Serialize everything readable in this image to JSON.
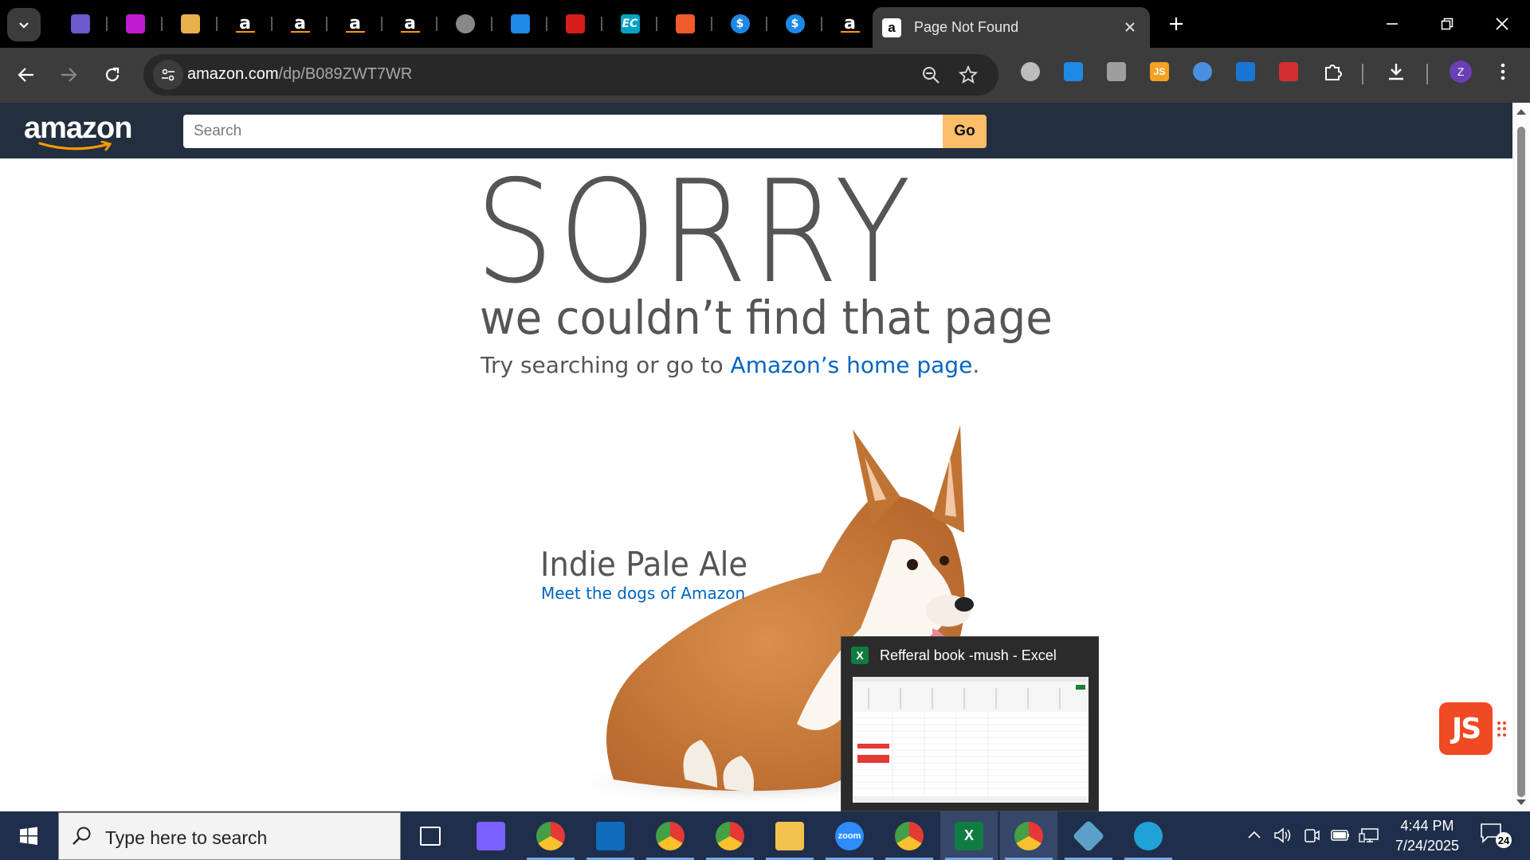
{
  "browser": {
    "pinned_tabs": [
      {
        "icon": "cube-icon",
        "color": "#6a5acd"
      },
      {
        "icon": "heart-app-icon",
        "color": "#c21ad1"
      },
      {
        "icon": "box-icon",
        "color": "#e8b04b"
      },
      {
        "icon": "amazon-icon",
        "color": "#ffffff"
      },
      {
        "icon": "amazon-icon",
        "color": "#ffffff"
      },
      {
        "icon": "amazon-icon",
        "color": "#ffffff"
      },
      {
        "icon": "amazon-icon",
        "color": "#ffffff"
      },
      {
        "icon": "globe-icon",
        "color": "#888888"
      },
      {
        "icon": "g-app-icon",
        "color": "#1e88e5"
      },
      {
        "icon": "dh-icon",
        "color": "#d81b1b"
      },
      {
        "icon": "ec-icon",
        "color": "#00a3c4",
        "text": "EC"
      },
      {
        "icon": "stack-icon",
        "color": "#ef5b2b"
      },
      {
        "icon": "dollar-icon",
        "color": "#1e88e5",
        "text": "$"
      },
      {
        "icon": "dollar-icon",
        "color": "#1e88e5",
        "text": "$"
      },
      {
        "icon": "amazon-icon",
        "color": "#ffffff"
      }
    ],
    "active_tab": {
      "title": "Page Not Found"
    },
    "url": {
      "domain": "amazon.com",
      "path": "/dp/B089ZWT7WR"
    },
    "profile_initial": "Z",
    "extensions": [
      {
        "icon": "globe-grid-icon",
        "color": "#bdbdbd"
      },
      {
        "icon": "puzzle-plus-icon",
        "color": "#1e88e5"
      },
      {
        "icon": "bike-icon",
        "color": "#9e9e9e"
      },
      {
        "icon": "js-icon",
        "color": "#f4a024",
        "text": "JS"
      },
      {
        "icon": "circle-icon",
        "color": "#4a90e2"
      },
      {
        "icon": "bars-icon",
        "color": "#1976d2"
      },
      {
        "icon": "arrow-icon",
        "color": "#d32f2f"
      }
    ]
  },
  "amazon": {
    "logo_text": "amazon",
    "search_placeholder": "Search",
    "go_label": "Go",
    "heading": "SORRY",
    "subheading": "we couldn’t find that page",
    "try_prefix": "Try searching or go to ",
    "home_link": "Amazon’s home page",
    "try_suffix": ".",
    "dog_name": "Indie Pale Ale",
    "dog_link": "Meet the dogs of Amazon",
    "fab_label": "JS"
  },
  "excel_preview": {
    "title": "Refferal book -mush - Excel",
    "icon_letter": "X"
  },
  "taskbar": {
    "search_placeholder": "Type here to search",
    "apps": [
      {
        "name": "task-view-icon"
      },
      {
        "name": "copilot-icon"
      },
      {
        "name": "chrome-profile-icon"
      },
      {
        "name": "outlook-icon"
      },
      {
        "name": "chrome-profile-icon"
      },
      {
        "name": "chrome-profile-icon"
      },
      {
        "name": "file-explorer-icon"
      },
      {
        "name": "zoom-icon",
        "text": "zoom"
      },
      {
        "name": "chrome-icon"
      },
      {
        "name": "excel-icon",
        "text": "X"
      },
      {
        "name": "chrome-profile-z-icon"
      },
      {
        "name": "diamond-app-icon"
      },
      {
        "name": "edge-icon"
      }
    ],
    "time": "4:44 PM",
    "date": "7/24/2025",
    "notification_count": "24"
  },
  "colors": {
    "amazon_nav": "#232f3e",
    "amazon_go": "#febd69",
    "link_blue": "#0066c0",
    "taskbar": "#1f2e4a"
  }
}
